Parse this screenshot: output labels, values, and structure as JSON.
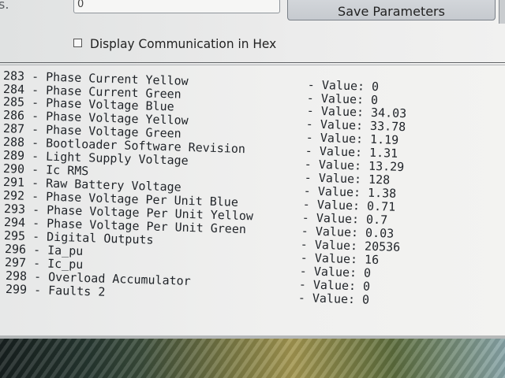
{
  "header": {
    "left_label": "s.",
    "field_value": "0",
    "save_button_label": "Save Parameters",
    "display_hex_label": "Display Communication in Hex",
    "display_hex_checked": false
  },
  "parameters": [
    {
      "id": "283",
      "name": "Phase Current Yellow",
      "value_label": "- Value:",
      "value": "0"
    },
    {
      "id": "284",
      "name": "Phase Current Green",
      "value_label": "- Value:",
      "value": "0"
    },
    {
      "id": "285",
      "name": "Phase Voltage Blue",
      "value_label": "- Value:",
      "value": "34.03"
    },
    {
      "id": "286",
      "name": "Phase Voltage Yellow",
      "value_label": "- Value:",
      "value": "33.78"
    },
    {
      "id": "287",
      "name": "Phase Voltage Green",
      "value_label": "- Value:",
      "value": "1.19"
    },
    {
      "id": "288",
      "name": "Bootloader Software Revision",
      "value_label": "- Value:",
      "value": "1.31"
    },
    {
      "id": "289",
      "name": "Light Supply Voltage",
      "value_label": "- Value:",
      "value": "13.29"
    },
    {
      "id": "290",
      "name": "Ic RMS",
      "value_label": "- Value:",
      "value": "128"
    },
    {
      "id": "291",
      "name": "Raw Battery Voltage",
      "value_label": "- Value:",
      "value": "1.38"
    },
    {
      "id": "292",
      "name": "Phase Voltage Per Unit Blue",
      "value_label": "- Value:",
      "value": "0.71"
    },
    {
      "id": "293",
      "name": "Phase Voltage Per Unit Yellow",
      "value_label": "- Value:",
      "value": "0.7"
    },
    {
      "id": "294",
      "name": "Phase Voltage Per Unit Green",
      "value_label": "- Value:",
      "value": "0.03"
    },
    {
      "id": "295",
      "name": "Digital Outputs",
      "value_label": "- Value:",
      "value": "20536"
    },
    {
      "id": "296",
      "name": "Ia_pu",
      "value_label": "- Value:",
      "value": "16"
    },
    {
      "id": "297",
      "name": "Ic_pu",
      "value_label": "- Value:",
      "value": "0"
    },
    {
      "id": "298",
      "name": "Overload Accumulator",
      "value_label": "- Value:",
      "value": "0"
    },
    {
      "id": "299",
      "name": "Faults 2",
      "value_label": "- Value:",
      "value": "0"
    }
  ]
}
